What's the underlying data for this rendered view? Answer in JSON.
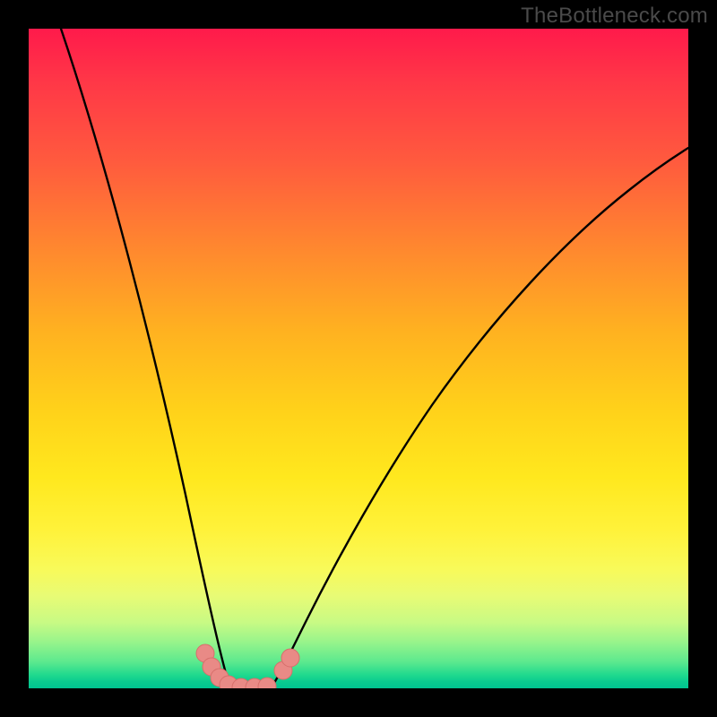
{
  "watermark": "TheBottleneck.com",
  "colors": {
    "frame": "#000000",
    "curve": "#000000",
    "marker_fill": "#e98a86",
    "marker_stroke": "#d66f6b"
  },
  "chart_data": {
    "type": "line",
    "title": "",
    "xlabel": "",
    "ylabel": "",
    "xlim": [
      0,
      100
    ],
    "ylim": [
      0,
      100
    ],
    "grid": false,
    "legend": false,
    "note": "Axes are unlabeled in the source image; x/y values are normalized 0–100 estimates from pixel positions.",
    "series": [
      {
        "name": "left-branch",
        "x": [
          5,
          10,
          15,
          18,
          20,
          22,
          24,
          26,
          27,
          28,
          29,
          30
        ],
        "y": [
          100,
          70,
          42,
          28,
          20,
          13,
          8,
          4,
          2.5,
          1.5,
          0.7,
          0
        ]
      },
      {
        "name": "valley-floor",
        "x": [
          30,
          31,
          32,
          33,
          34,
          35,
          36,
          37
        ],
        "y": [
          0,
          0,
          0,
          0,
          0,
          0,
          0,
          0
        ]
      },
      {
        "name": "right-branch",
        "x": [
          37,
          39,
          42,
          46,
          50,
          55,
          60,
          66,
          72,
          80,
          88,
          96,
          100
        ],
        "y": [
          0,
          3,
          8,
          15,
          22,
          31,
          39,
          48,
          55,
          64,
          72,
          79,
          82
        ]
      }
    ],
    "markers": [
      {
        "x": 26.5,
        "y": 5.0
      },
      {
        "x": 27.5,
        "y": 3.0
      },
      {
        "x": 28.7,
        "y": 1.3
      },
      {
        "x": 30.0,
        "y": 0.3
      },
      {
        "x": 32.0,
        "y": 0.0
      },
      {
        "x": 34.0,
        "y": 0.0
      },
      {
        "x": 36.0,
        "y": 0.2
      },
      {
        "x": 38.5,
        "y": 2.5
      },
      {
        "x": 39.5,
        "y": 4.5
      }
    ]
  }
}
